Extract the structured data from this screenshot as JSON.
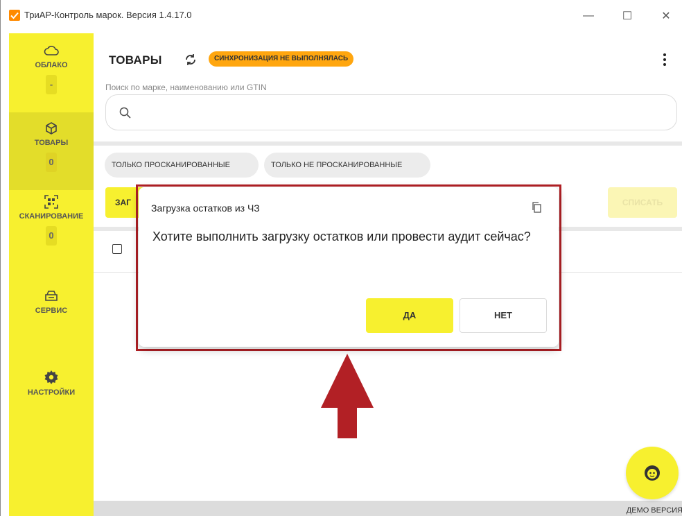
{
  "window": {
    "title": "ТриАР-Контроль марок. Версия 1.4.17.0",
    "minimize": "—",
    "maximize": "☐",
    "close": "✕"
  },
  "sidebar": {
    "items": [
      {
        "label": "ОБЛАКО",
        "badge": "-",
        "icon": "cloud-icon"
      },
      {
        "label": "ТОВАРЫ",
        "badge": "0",
        "icon": "box-icon",
        "active": true
      },
      {
        "label": "СКАНИРОВАНИЕ",
        "badge": "0",
        "icon": "qr-scan-icon"
      },
      {
        "label": "СЕРВИС",
        "icon": "service-icon"
      },
      {
        "label": "НАСТРОЙКИ",
        "icon": "gear-icon"
      }
    ]
  },
  "main": {
    "title": "ТОВАРЫ",
    "sync_badge": "СИНХРОНИЗАЦИЯ НЕ ВЫПОЛНЯЛАСЬ",
    "search": {
      "label": "Поиск по марке, наименованию или GTIN",
      "value": ""
    },
    "filters": [
      "ТОЛЬКО ПРОСКАНИРОВАННЫЕ",
      "ТОЛЬКО НЕ ПРОСКАНИРОВАННЫЕ"
    ],
    "load_button": "ЗАГ",
    "writeoff_button": "СПИСАТЬ",
    "demo_label": "ДЕМО ВЕРСИЯ"
  },
  "dialog": {
    "title": "Загрузка остатков из ЧЗ",
    "message": "Хотите выполнить загрузку остатков или провести аудит сейчас?",
    "yes": "ДА",
    "no": "НЕТ"
  },
  "colors": {
    "accent_yellow": "#f7f02f",
    "sync_orange": "#ffa60f",
    "annotation_red": "#b22025"
  }
}
